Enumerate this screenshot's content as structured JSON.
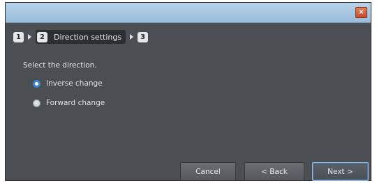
{
  "window": {
    "close_icon": "close-icon",
    "close_glyph": "×"
  },
  "steps": [
    {
      "number": "1",
      "label": ""
    },
    {
      "number": "2",
      "label": "Direction settings"
    },
    {
      "number": "3",
      "label": ""
    }
  ],
  "prompt": "Select the direction.",
  "options": [
    {
      "label": "Inverse change",
      "checked": true
    },
    {
      "label": "Forward change",
      "checked": false
    }
  ],
  "buttons": {
    "cancel": "Cancel",
    "back": "< Back",
    "next": "Next >"
  },
  "colors": {
    "window_bg": "#4b4e52",
    "title_bar": "#a8c6e2",
    "accent": "#3b86c9",
    "close": "#c24a2c"
  }
}
